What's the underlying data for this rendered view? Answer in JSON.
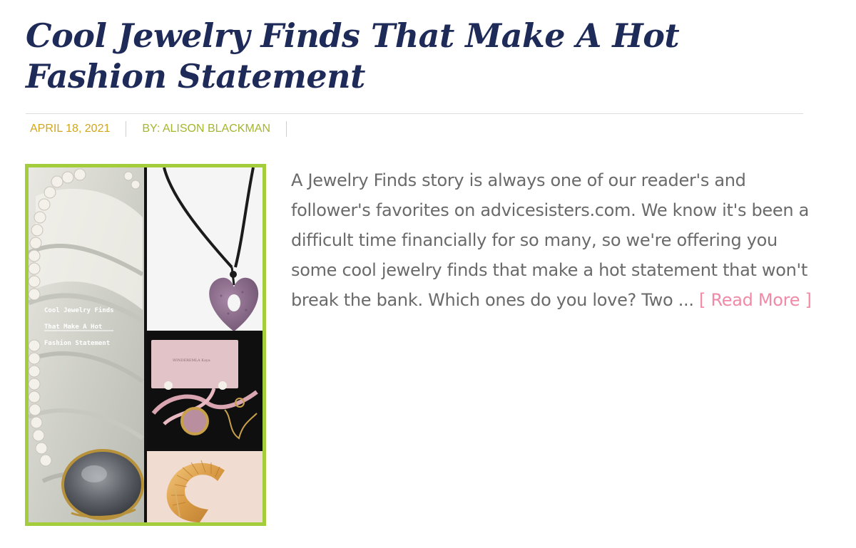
{
  "post": {
    "title": "Cool Jewelry Finds That Make A Hot Fashion Statement",
    "date": "APRIL 18, 2021",
    "author": "BY: ALISON BLACKMAN",
    "excerpt": "A Jewelry Finds story is always one of our reader's and follower's favorites on advicesisters.com. We know it's been a difficult time financially for so many, so we're offering you some cool jewelry finds that make a hot statement that won't break the bank.  Which ones do you love?   Two ... ",
    "read_more": "[ Read More ]"
  },
  "image": {
    "caption_lines": [
      "Cool Jewelry Finds",
      "That Make A Hot",
      "Fashion Statement"
    ],
    "pouch_text": "WINDEREMLA Kaya"
  },
  "colors": {
    "title": "#1e2a57",
    "date": "#d2a61c",
    "author": "#a6b52e",
    "excerpt": "#6a6a6a",
    "read_more": "#f08aa6",
    "frame": "#a3cd3b"
  }
}
